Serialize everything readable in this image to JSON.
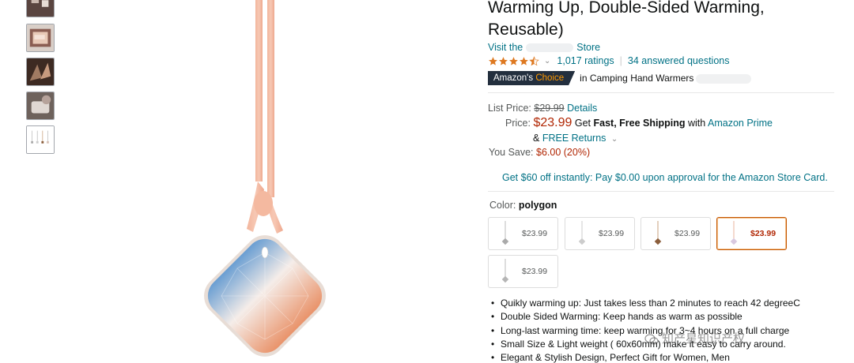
{
  "product": {
    "title_line1": "Warming Up, Double-Sided Warming,",
    "title_line2": "Reusable)",
    "visit_prefix": "Visit the",
    "visit_suffix": "Store",
    "ratings": "1,017 ratings",
    "answered": "34 answered questions",
    "badge_amazons": "Amazon's",
    "badge_choice": "Choice",
    "badge_category": "in Camping Hand Warmers"
  },
  "pricing": {
    "list_label": "List Price:",
    "list_value": "$29.99",
    "details": "Details",
    "price_label": "Price:",
    "price_value": "$23.99",
    "get": "Get",
    "fast_shipping": "Fast, Free Shipping",
    "with": "with",
    "prime": "Amazon Prime",
    "amp": "&",
    "free_returns": "FREE Returns",
    "you_save_label": "You Save:",
    "you_save_value": "$6.00 (20%)"
  },
  "promo": "Get $60 off instantly: Pay $0.00 upon approval for the Amazon Store Card.",
  "color": {
    "label": "Color:",
    "value": "polygon",
    "swatches": [
      {
        "price": "$23.99",
        "selected": false
      },
      {
        "price": "$23.99",
        "selected": false
      },
      {
        "price": "$23.99",
        "selected": false
      },
      {
        "price": "$23.99",
        "selected": true
      },
      {
        "price": "$23.99",
        "selected": false
      }
    ]
  },
  "bullets": [
    "Quikly warming up: Just takes less than 2 minutes to reach 42 degreeC",
    "Double Sided Warming: Keep hands as warm as possible",
    "Long-last warming time: keep warming for 3~4 hours on a full charge",
    "Small Size & Light weight ( 60x60mm) make it easy to carry around.",
    "Elegant & Stylish Design, Perfect Gift for Women, Men"
  ],
  "watermark": "知产星知识产权",
  "colors": {
    "link": "#007185",
    "price_red": "#b12704",
    "badge_bg": "#232f3e",
    "badge_orange": "#ff9900",
    "star": "#de7921"
  }
}
